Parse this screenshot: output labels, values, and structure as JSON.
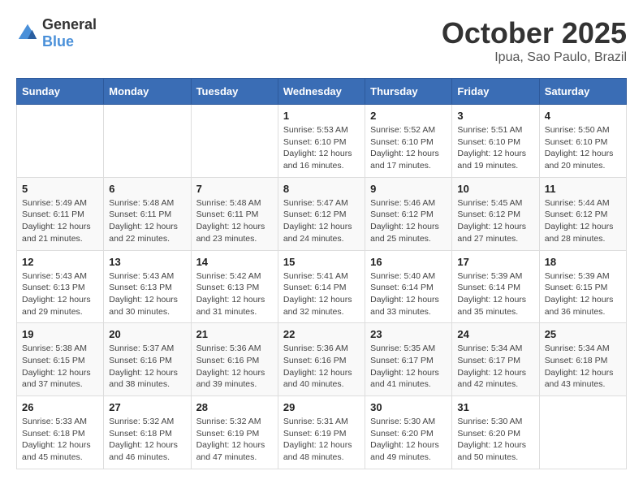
{
  "header": {
    "logo_general": "General",
    "logo_blue": "Blue",
    "title": "October 2025",
    "location": "Ipua, Sao Paulo, Brazil"
  },
  "weekdays": [
    "Sunday",
    "Monday",
    "Tuesday",
    "Wednesday",
    "Thursday",
    "Friday",
    "Saturday"
  ],
  "weeks": [
    [
      {
        "day": "",
        "info": ""
      },
      {
        "day": "",
        "info": ""
      },
      {
        "day": "",
        "info": ""
      },
      {
        "day": "1",
        "info": "Sunrise: 5:53 AM\nSunset: 6:10 PM\nDaylight: 12 hours\nand 16 minutes."
      },
      {
        "day": "2",
        "info": "Sunrise: 5:52 AM\nSunset: 6:10 PM\nDaylight: 12 hours\nand 17 minutes."
      },
      {
        "day": "3",
        "info": "Sunrise: 5:51 AM\nSunset: 6:10 PM\nDaylight: 12 hours\nand 19 minutes."
      },
      {
        "day": "4",
        "info": "Sunrise: 5:50 AM\nSunset: 6:10 PM\nDaylight: 12 hours\nand 20 minutes."
      }
    ],
    [
      {
        "day": "5",
        "info": "Sunrise: 5:49 AM\nSunset: 6:11 PM\nDaylight: 12 hours\nand 21 minutes."
      },
      {
        "day": "6",
        "info": "Sunrise: 5:48 AM\nSunset: 6:11 PM\nDaylight: 12 hours\nand 22 minutes."
      },
      {
        "day": "7",
        "info": "Sunrise: 5:48 AM\nSunset: 6:11 PM\nDaylight: 12 hours\nand 23 minutes."
      },
      {
        "day": "8",
        "info": "Sunrise: 5:47 AM\nSunset: 6:12 PM\nDaylight: 12 hours\nand 24 minutes."
      },
      {
        "day": "9",
        "info": "Sunrise: 5:46 AM\nSunset: 6:12 PM\nDaylight: 12 hours\nand 25 minutes."
      },
      {
        "day": "10",
        "info": "Sunrise: 5:45 AM\nSunset: 6:12 PM\nDaylight: 12 hours\nand 27 minutes."
      },
      {
        "day": "11",
        "info": "Sunrise: 5:44 AM\nSunset: 6:12 PM\nDaylight: 12 hours\nand 28 minutes."
      }
    ],
    [
      {
        "day": "12",
        "info": "Sunrise: 5:43 AM\nSunset: 6:13 PM\nDaylight: 12 hours\nand 29 minutes."
      },
      {
        "day": "13",
        "info": "Sunrise: 5:43 AM\nSunset: 6:13 PM\nDaylight: 12 hours\nand 30 minutes."
      },
      {
        "day": "14",
        "info": "Sunrise: 5:42 AM\nSunset: 6:13 PM\nDaylight: 12 hours\nand 31 minutes."
      },
      {
        "day": "15",
        "info": "Sunrise: 5:41 AM\nSunset: 6:14 PM\nDaylight: 12 hours\nand 32 minutes."
      },
      {
        "day": "16",
        "info": "Sunrise: 5:40 AM\nSunset: 6:14 PM\nDaylight: 12 hours\nand 33 minutes."
      },
      {
        "day": "17",
        "info": "Sunrise: 5:39 AM\nSunset: 6:14 PM\nDaylight: 12 hours\nand 35 minutes."
      },
      {
        "day": "18",
        "info": "Sunrise: 5:39 AM\nSunset: 6:15 PM\nDaylight: 12 hours\nand 36 minutes."
      }
    ],
    [
      {
        "day": "19",
        "info": "Sunrise: 5:38 AM\nSunset: 6:15 PM\nDaylight: 12 hours\nand 37 minutes."
      },
      {
        "day": "20",
        "info": "Sunrise: 5:37 AM\nSunset: 6:16 PM\nDaylight: 12 hours\nand 38 minutes."
      },
      {
        "day": "21",
        "info": "Sunrise: 5:36 AM\nSunset: 6:16 PM\nDaylight: 12 hours\nand 39 minutes."
      },
      {
        "day": "22",
        "info": "Sunrise: 5:36 AM\nSunset: 6:16 PM\nDaylight: 12 hours\nand 40 minutes."
      },
      {
        "day": "23",
        "info": "Sunrise: 5:35 AM\nSunset: 6:17 PM\nDaylight: 12 hours\nand 41 minutes."
      },
      {
        "day": "24",
        "info": "Sunrise: 5:34 AM\nSunset: 6:17 PM\nDaylight: 12 hours\nand 42 minutes."
      },
      {
        "day": "25",
        "info": "Sunrise: 5:34 AM\nSunset: 6:18 PM\nDaylight: 12 hours\nand 43 minutes."
      }
    ],
    [
      {
        "day": "26",
        "info": "Sunrise: 5:33 AM\nSunset: 6:18 PM\nDaylight: 12 hours\nand 45 minutes."
      },
      {
        "day": "27",
        "info": "Sunrise: 5:32 AM\nSunset: 6:18 PM\nDaylight: 12 hours\nand 46 minutes."
      },
      {
        "day": "28",
        "info": "Sunrise: 5:32 AM\nSunset: 6:19 PM\nDaylight: 12 hours\nand 47 minutes."
      },
      {
        "day": "29",
        "info": "Sunrise: 5:31 AM\nSunset: 6:19 PM\nDaylight: 12 hours\nand 48 minutes."
      },
      {
        "day": "30",
        "info": "Sunrise: 5:30 AM\nSunset: 6:20 PM\nDaylight: 12 hours\nand 49 minutes."
      },
      {
        "day": "31",
        "info": "Sunrise: 5:30 AM\nSunset: 6:20 PM\nDaylight: 12 hours\nand 50 minutes."
      },
      {
        "day": "",
        "info": ""
      }
    ]
  ]
}
